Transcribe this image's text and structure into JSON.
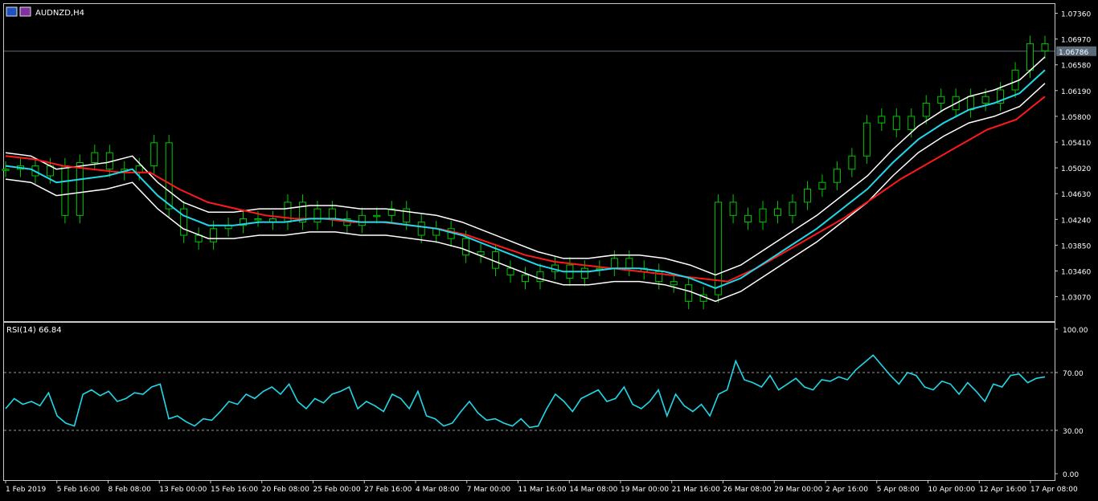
{
  "window": {
    "symbol_label": "AUDNZD,H4"
  },
  "indicator": {
    "label": "RSI(14) 66.84"
  },
  "colors": {
    "background": "#000000",
    "frame": "#c8c8c8",
    "candles": "#00c800",
    "bollinger": "#ffffff",
    "ma_fast": "#20d8e8",
    "ma_slow": "#ff1a1a",
    "rsi": "#20d8e8",
    "price_line": "#5a6a7a",
    "price_tag": "#5a6a7a"
  },
  "chart_data": [
    {
      "type": "line",
      "title": "AUDNZD,H4",
      "price_axis": {
        "ticks": [
          "1.07360",
          "1.06970",
          "1.06580",
          "1.06190",
          "1.05800",
          "1.05410",
          "1.05020",
          "1.04630",
          "1.04240",
          "1.03850",
          "1.03460",
          "1.03070"
        ],
        "ylim": [
          1.027,
          1.075
        ]
      },
      "current_price": "1.06786",
      "x_ticks": [
        "1 Feb 2019",
        "5 Feb 16:00",
        "8 Feb 08:00",
        "13 Feb 00:00",
        "15 Feb 16:00",
        "20 Feb 08:00",
        "25 Feb 00:00",
        "27 Feb 16:00",
        "4 Mar 08:00",
        "7 Mar 00:00",
        "11 Mar 16:00",
        "14 Mar 08:00",
        "19 Mar 00:00",
        "21 Mar 16:00",
        "26 Mar 08:00",
        "29 Mar 00:00",
        "2 Apr 16:00",
        "5 Apr 08:00",
        "10 Apr 00:00",
        "12 Apr 16:00",
        "17 Apr 08:00"
      ],
      "series": [
        {
          "kind": "candles-close",
          "values": [
            1.05,
            1.0505,
            1.049,
            1.0505,
            1.043,
            1.051,
            1.0525,
            1.05,
            1.0495,
            1.0505,
            1.054,
            1.044,
            1.04,
            1.039,
            1.041,
            1.0415,
            1.0425,
            1.0425,
            1.042,
            1.045,
            1.042,
            1.044,
            1.0425,
            1.0415,
            1.043,
            1.043,
            1.044,
            1.042,
            1.04,
            1.041,
            1.0395,
            1.037,
            1.0375,
            1.035,
            1.034,
            1.033,
            1.0345,
            1.0355,
            1.0335,
            1.035,
            1.035,
            1.0365,
            1.035,
            1.0345,
            1.033,
            1.0325,
            1.03,
            1.031,
            1.045,
            1.043,
            1.042,
            1.044,
            1.043,
            1.045,
            1.047,
            1.048,
            1.05,
            1.052,
            1.057,
            1.058,
            1.056,
            1.058,
            1.06,
            1.061,
            1.059,
            1.061,
            1.06,
            1.062,
            1.065,
            1.069,
            1.0679
          ]
        },
        {
          "name": "",
          "kind": "ma-fast",
          "values": [
            1.0505,
            1.05,
            1.048,
            1.0485,
            1.049,
            1.05,
            1.046,
            1.043,
            1.0415,
            1.0415,
            1.042,
            1.042,
            1.0425,
            1.0425,
            1.042,
            1.042,
            1.0415,
            1.041,
            1.04,
            1.0385,
            1.037,
            1.0355,
            1.0345,
            1.0345,
            1.035,
            1.035,
            1.0345,
            1.0335,
            1.032,
            1.0335,
            1.036,
            1.0385,
            1.041,
            1.044,
            1.047,
            1.051,
            1.0545,
            1.057,
            1.059,
            1.06,
            1.0615,
            1.065
          ]
        },
        {
          "name": "",
          "kind": "ma-slow",
          "values": [
            1.052,
            1.0515,
            1.0505,
            1.05,
            1.0495,
            1.0495,
            1.047,
            1.045,
            1.044,
            1.043,
            1.0425,
            1.0425,
            1.042,
            1.042,
            1.0415,
            1.041,
            1.04,
            1.0385,
            1.037,
            1.036,
            1.0355,
            1.035,
            1.0345,
            1.034,
            1.0335,
            1.033,
            1.035,
            1.0375,
            1.04,
            1.0425,
            1.0455,
            1.0485,
            1.051,
            1.0535,
            1.056,
            1.0575,
            1.061
          ]
        }
      ]
    },
    {
      "type": "line",
      "title": "RSI(14) 66.84",
      "ylim": [
        0,
        100
      ],
      "y_ticks": [
        "100.00",
        "70.00",
        "30.00",
        "0.00"
      ],
      "levels": [
        70,
        30
      ],
      "series": [
        {
          "name": "",
          "values": [
            45,
            52,
            48,
            50,
            47,
            56,
            40,
            35,
            33,
            55,
            58,
            54,
            57,
            50,
            52,
            56,
            55,
            60,
            62,
            38,
            40,
            36,
            33,
            38,
            37,
            43,
            50,
            48,
            55,
            52,
            57,
            60,
            55,
            62,
            50,
            45,
            52,
            49,
            55,
            57,
            60,
            45,
            50,
            47,
            43,
            55,
            52,
            45,
            57,
            40,
            38,
            33,
            35,
            43,
            50,
            42,
            37,
            38,
            35,
            33,
            38,
            32,
            33,
            45,
            55,
            50,
            43,
            52,
            55,
            58,
            50,
            52,
            60,
            48,
            45,
            50,
            58,
            40,
            55,
            47,
            43,
            48,
            40,
            55,
            58,
            78,
            65,
            63,
            60,
            68,
            58,
            62,
            66,
            60,
            58,
            65,
            64,
            67,
            65,
            72,
            77,
            82,
            75,
            68,
            62,
            70,
            68,
            60,
            58,
            64,
            62,
            55,
            63,
            57,
            50,
            62,
            60,
            68,
            69,
            63,
            66,
            67
          ]
        }
      ]
    }
  ]
}
